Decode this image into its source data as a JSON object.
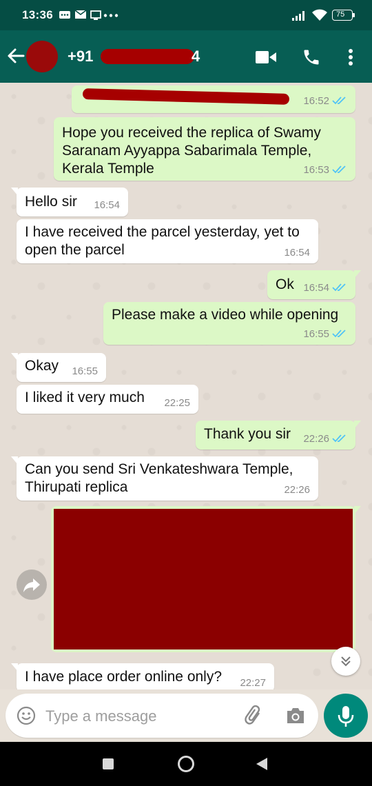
{
  "status_bar": {
    "time": "13:36",
    "battery": "75"
  },
  "header": {
    "contact_prefix": "+91",
    "contact_suffix": "4"
  },
  "messages": [
    {
      "dir": "out",
      "text": "",
      "time": "16:52",
      "ticks": "read"
    },
    {
      "dir": "out",
      "lines": [
        "Hope you received the replica of Swamy",
        "Saranam Ayyappa Sabarimala Temple,",
        "Kerala Temple"
      ],
      "time": "16:53",
      "ticks": "read"
    },
    {
      "dir": "in",
      "text": "Hello sir",
      "time": "16:54"
    },
    {
      "dir": "in",
      "lines": [
        "I have received the parcel yesterday, yet to",
        "open the parcel"
      ],
      "time": "16:54"
    },
    {
      "dir": "out",
      "text": "Ok",
      "time": "16:54",
      "ticks": "read"
    },
    {
      "dir": "out",
      "text": "Please make a video while opening",
      "time": "16:55",
      "ticks": "read"
    },
    {
      "dir": "in",
      "text": "Okay",
      "time": "16:55"
    },
    {
      "dir": "in",
      "text": "I liked it very much",
      "time": "22:25"
    },
    {
      "dir": "out",
      "text": "Thank you sir",
      "time": "22:26",
      "ticks": "read"
    },
    {
      "dir": "in",
      "lines": [
        "Can you send Sri Venkateshwara Temple,",
        "Thirupati replica"
      ],
      "time": "22:26"
    },
    {
      "dir": "in",
      "text": "I have place order online only?",
      "time": "22:27"
    }
  ],
  "composer": {
    "placeholder": "Type a message"
  },
  "colors": {
    "header": "#075e54",
    "status_bar": "#054d44",
    "outgoing": "#dcf8c6",
    "incoming": "#ffffff",
    "mic": "#00897b",
    "read_ticks": "#4fc3f7"
  },
  "icons": [
    "back-arrow-icon",
    "video-call-icon",
    "phone-icon",
    "more-vert-icon",
    "forward-icon",
    "scroll-down-icon",
    "emoji-icon",
    "attach-icon",
    "camera-icon",
    "mic-icon",
    "nav-recents-icon",
    "nav-home-icon",
    "nav-back-icon"
  ]
}
